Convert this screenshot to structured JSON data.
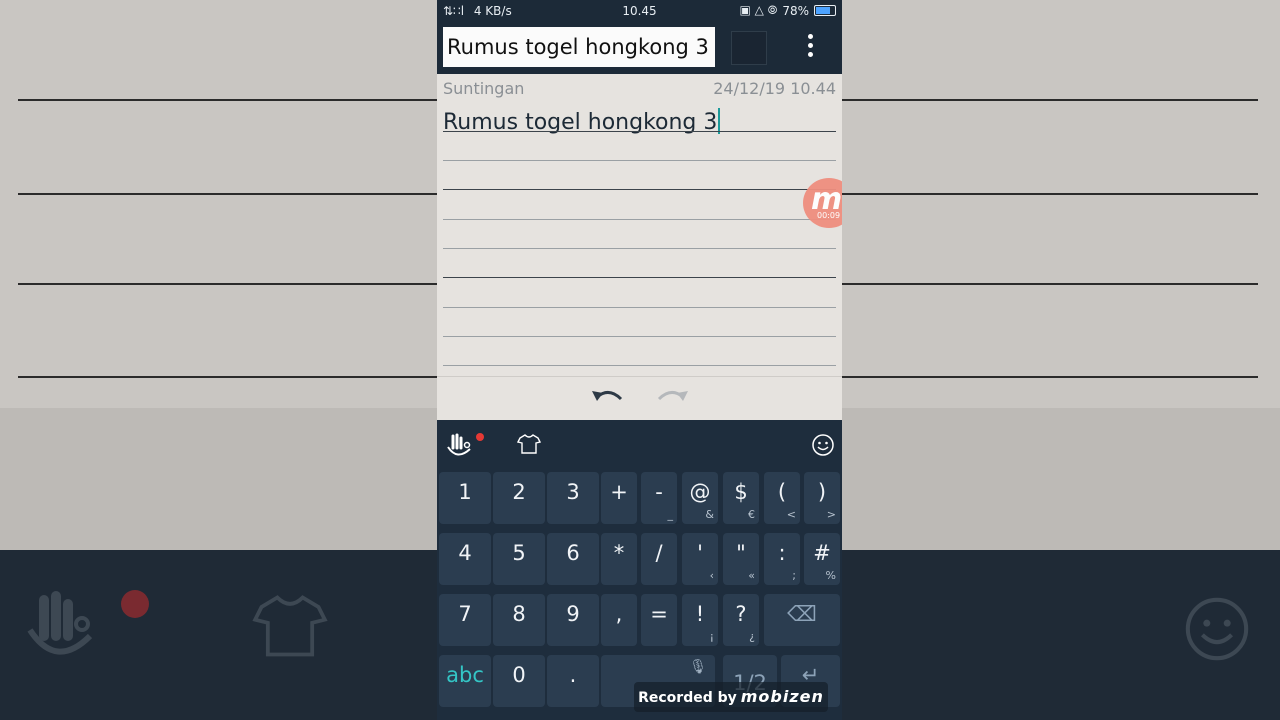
{
  "statusbar": {
    "signal": "⇅∷l",
    "speed": "4 KB/s",
    "time": "10.45",
    "icons": "▣ △ ⦾",
    "battery_text": "78%"
  },
  "appbar": {
    "title_value": "Rumus togel hongkong 3",
    "swatch_color": "#1a2532"
  },
  "note": {
    "meta_label": "Suntingan",
    "meta_date": "24/12/19 10.44",
    "body": "Rumus togel hongkong 3"
  },
  "recorder_bubble": {
    "glyph": "m",
    "timer": "00:09"
  },
  "keyboard": {
    "rows": [
      [
        {
          "main": "1"
        },
        {
          "main": "2"
        },
        {
          "main": "3"
        },
        {
          "main": "+"
        },
        {
          "main": "-",
          "sub": "_"
        },
        {
          "main": "@",
          "sub": "&"
        },
        {
          "main": "$",
          "sub": "€"
        },
        {
          "main": "(",
          "sub": "<"
        },
        {
          "main": ")",
          "sub": ">"
        }
      ],
      [
        {
          "main": "4"
        },
        {
          "main": "5"
        },
        {
          "main": "6"
        },
        {
          "main": "*"
        },
        {
          "main": "/"
        },
        {
          "main": "'",
          "sub": "‹"
        },
        {
          "main": "\"",
          "sub": "«"
        },
        {
          "main": ":",
          "sub": ";"
        },
        {
          "main": "#",
          "sub": "%"
        }
      ],
      [
        {
          "main": "7"
        },
        {
          "main": "8"
        },
        {
          "main": "9"
        },
        {
          "main": ","
        },
        {
          "main": "="
        },
        {
          "main": "!",
          "sub": "¡"
        },
        {
          "main": "?",
          "sub": "¿"
        }
      ],
      [
        {
          "main": "abc"
        },
        {
          "main": "0"
        },
        {
          "main": "."
        },
        {
          "main": "1/2"
        }
      ]
    ],
    "backspace_glyph": "⌫",
    "enter_glyph": "↵",
    "mic_glyph": "🎙"
  },
  "watermark": {
    "prefix": "Recorded by",
    "brand": "mobizen"
  },
  "colors": {
    "keyboard_bg": "#1e2d3d",
    "key_bg": "#2b3d50",
    "accent": "#34c6c6",
    "note_bg": "#e6e3df"
  }
}
